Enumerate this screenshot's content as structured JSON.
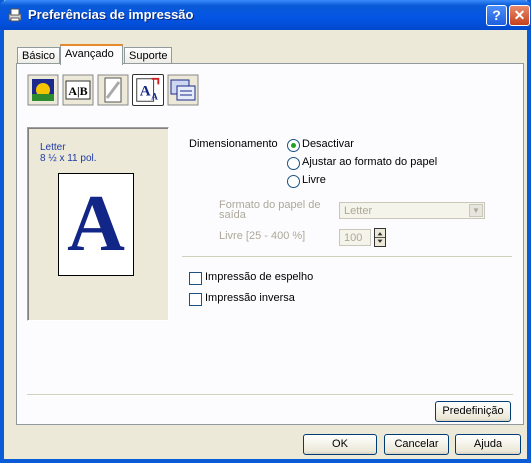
{
  "window": {
    "title": "Preferências de impressão",
    "help_glyph": "?",
    "close_glyph": "✕"
  },
  "tabs": [
    {
      "label": "Básico"
    },
    {
      "label": "Avançado"
    },
    {
      "label": "Suporte"
    }
  ],
  "toolbar": {
    "icons": [
      "color-quality-icon",
      "duplex-ab-icon",
      "watermark-copy-icon",
      "scaling-icon",
      "device-options-icon"
    ],
    "selected": "scaling-icon",
    "duplex_text": "A|B"
  },
  "preview": {
    "paper_name": "Letter",
    "paper_size": "8 ½ x 11 pol.",
    "letter": "A"
  },
  "scaling": {
    "label": "Dimensionamento",
    "options": [
      {
        "label": "Desactivar",
        "checked": true
      },
      {
        "label": "Ajustar ao formato do papel",
        "checked": false
      },
      {
        "label": "Livre",
        "checked": false
      }
    ],
    "output_paper_label_line1": "Formato do papel de",
    "output_paper_label_line2": "saída",
    "output_paper_value": "Letter",
    "free_label": "Livre [25 - 400 %]",
    "free_value": "100"
  },
  "checkboxes": [
    {
      "label": "Impressão de espelho",
      "checked": false
    },
    {
      "label": "Impressão inversa",
      "checked": false
    }
  ],
  "buttons": {
    "default": "Predefinição",
    "ok": "OK",
    "cancel": "Cancelar",
    "help": "Ajuda"
  },
  "colors": {
    "accent_title": "#0a5bd7",
    "preview_text": "#1f3aa6",
    "big_letter": "#122687"
  }
}
